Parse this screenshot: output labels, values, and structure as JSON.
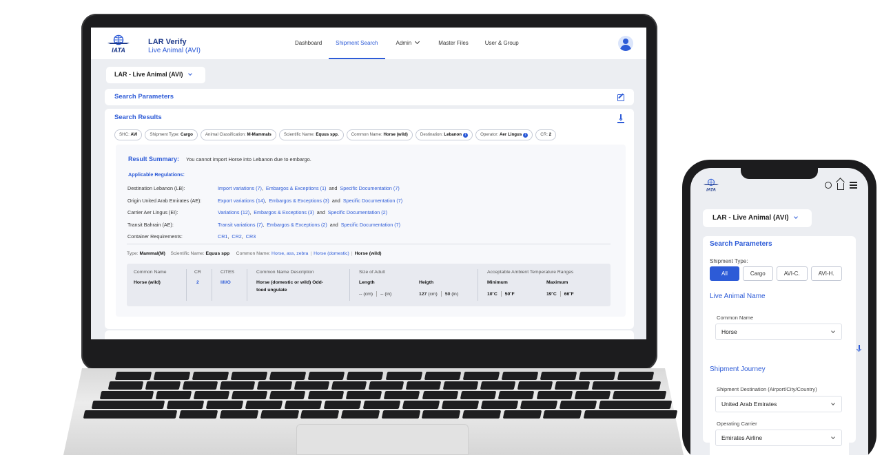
{
  "laptop": {
    "brand": {
      "title": "LAR Verify",
      "subtitle": "Live Animal (AVI)"
    },
    "nav": [
      {
        "label": "Dashboard"
      },
      {
        "label": "Shipment Search",
        "active": true
      },
      {
        "label": "Admin"
      },
      {
        "label": "Master Files"
      },
      {
        "label": "User & Group"
      }
    ],
    "product_select": "LAR - Live Animal (AVI)",
    "search_parameters_title": "Search Parameters",
    "search_results_title": "Search Results",
    "chips": [
      {
        "label": "SHC:",
        "value": "AVI"
      },
      {
        "label": "Shipment Type:",
        "value": "Cargo"
      },
      {
        "label": "Animal Classification:",
        "value": "M-Mammals"
      },
      {
        "label": "Scientific Name:",
        "value": "Equus spp."
      },
      {
        "label": "Common Name:",
        "value": "Horse (wild)"
      },
      {
        "label": "Destination:",
        "value": "Lebanon"
      },
      {
        "label": "Operator:",
        "value": "Aer Lingus"
      },
      {
        "label": "CR:",
        "value": "2"
      }
    ],
    "result_summary_label": "Result Summary:",
    "result_summary_text": "You cannot import Horse into Lebanon due to embargo.",
    "applicable_regulations_label": "Applicable Regulations:",
    "regulations": [
      {
        "label": "Destination Lebanon (LB):",
        "l1": "Import variations (7)",
        "l2": "Embargos & Exceptions (1)",
        "l3": "Specific Documentation (7)"
      },
      {
        "label": "Origin United Arab Emirates (AE):",
        "l1": "Export variations (14)",
        "l2": "Embargos & Exceptions (3)",
        "l3": "Specific Documentation (7)"
      },
      {
        "label": "Carrier Aer Lingus (EI):",
        "l1": "Variations (12)",
        "l2": "Embargos & Exceptions (3)",
        "l3": "Specific Documentation (2)"
      },
      {
        "label": "Transit Bahrain (AE):",
        "l1": "Transit variations (7)",
        "l2": "Embargos & Exceptions (2)",
        "l3": "Specific Documentation (7)"
      }
    ],
    "container_label": "Container Requirements:",
    "container_links": [
      "CR1",
      "CR2",
      "CR3"
    ],
    "and_word": "and",
    "type_row": {
      "type_label": "Type:",
      "type_value": "Mammal(M)",
      "sci_label": "Scientific Name:",
      "sci_value": "Equus spp",
      "common_label": "Common Name:",
      "common_links": [
        "Horse, ass, zebra",
        "Horse (domestic)",
        "Horse (wild)"
      ]
    },
    "table": {
      "headers": {
        "common_name": "Common Name",
        "cr": "CR",
        "cites": "CITES",
        "desc": "Common Name Description",
        "size": "Size of Adult",
        "temp": "Acceptable Ambient Temperature Ranges"
      },
      "sub_headers": {
        "length": "Length",
        "height": "Heigth",
        "min": "Minimum",
        "max": "Maximum"
      },
      "row": {
        "common_name": "Horse (wild)",
        "cr": "2",
        "cites": "I/II/O",
        "desc_line1": "Horse (domestic or wild) Odd-",
        "desc_line2": "toed ungulate",
        "length_cm": "-- (cm)",
        "length_in": "-- (in)",
        "height_cm_val": "127",
        "height_cm_unit": "(cm)",
        "height_in_val": "50",
        "height_in_unit": "(in)",
        "min_c": "10˚C",
        "min_f": "50˚F",
        "max_c": "19˚C",
        "max_f": "66˚F"
      }
    }
  },
  "phone": {
    "product_select": "LAR - Live Animal (AVI)",
    "search_parameters_title": "Search Parameters",
    "shipment_type_label": "Shipment Type:",
    "shipment_types": [
      "All",
      "Cargo",
      "AVI-C.",
      "AVI-H."
    ],
    "live_animal_name_title": "Live Animal Name",
    "common_name_label": "Common Name",
    "common_name_value": "Horse",
    "shipment_journey_title": "Shipment Journey",
    "destination_label": "Shipment Destination (Airport/City/Country)",
    "destination_value": "United Arab Emirates",
    "carrier_label": "Operating Carrier",
    "carrier_value": "Emirates Airline"
  },
  "brand_logo_text": "IATA",
  "colors": {
    "accent": "#2d5bd7",
    "bg": "#eceef2",
    "device": "#1c1c1e"
  }
}
